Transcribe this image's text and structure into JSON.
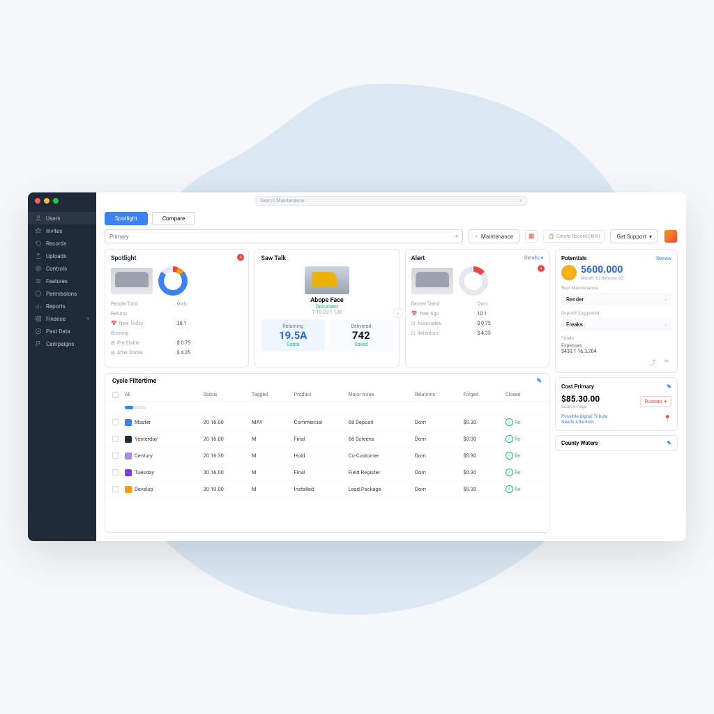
{
  "top_search_placeholder": "Search Maintenance",
  "sidebar": {
    "items": [
      {
        "label": "Users",
        "icon": "user"
      },
      {
        "label": "Invites",
        "icon": "star"
      },
      {
        "label": "Records",
        "icon": "reload"
      },
      {
        "label": "Uploads",
        "icon": "upload"
      },
      {
        "label": "Controls",
        "icon": "target"
      },
      {
        "label": "Features",
        "icon": "list"
      },
      {
        "label": "Permissions",
        "icon": "shield"
      },
      {
        "label": "Reports",
        "icon": "bar"
      },
      {
        "label": "Finance",
        "icon": "grid",
        "chev": true
      },
      {
        "label": "Past Data",
        "icon": "clock"
      },
      {
        "label": "Campaigns",
        "icon": "flag"
      }
    ]
  },
  "tabs": {
    "primary": "Spotlight",
    "secondary": "Compare"
  },
  "filters": {
    "primary_placeholder": "Primary",
    "maint_label": "Maintenance",
    "chip_label": "Create Record (⌘N)",
    "support_label": "Get Support"
  },
  "card1": {
    "title": "Spotlight",
    "k1": "People Total",
    "v1": "Owls",
    "rows": [
      {
        "k": "New Today",
        "v": "30.1"
      },
      {
        "k": "Pre-Stable",
        "v": "$ 0.75"
      },
      {
        "k": "After Stable",
        "v": "$ 4.25"
      }
    ],
    "sub1": "Returns",
    "sub2": "Running"
  },
  "card2": {
    "title": "Saw Talk",
    "name": "Abope Face",
    "sub": "Document",
    "sub2": "1.10 20:1 139",
    "stat1": {
      "lbl": "Returning",
      "val": "19.5A",
      "sub": "Costs"
    },
    "stat2": {
      "lbl": "Delivered",
      "val": "742",
      "sub": "Saved"
    }
  },
  "card3": {
    "title": "Alert",
    "head_action": "Details",
    "k1": "Recent Trend",
    "v1": "Owls",
    "rows": [
      {
        "k": "Year Ago",
        "v": "10.1"
      },
      {
        "k": "Associates",
        "v": "$ 0.75"
      },
      {
        "k": "Retention",
        "v": "$ 4.35"
      }
    ]
  },
  "table": {
    "title": "Cycle Filtertime",
    "headers": [
      "",
      "All",
      "Status",
      "Tagged",
      "Product",
      "Major Issue",
      "Relations",
      "Forged",
      "Closed"
    ],
    "rows": [
      {
        "color": "#3b82f6",
        "name": "Master",
        "c2": "20 16.00",
        "c3": "MAY",
        "c4": "Commercial",
        "c5": "68 Deposit",
        "c6": "Dorn",
        "c7": "$0.30",
        "c8": "Re"
      },
      {
        "color": "#1f2937",
        "name": "Yesterday",
        "c2": "20 16.00",
        "c3": "M",
        "c4": "Final",
        "c5": "68 Screens",
        "c6": "Dorn",
        "c7": "$0.30",
        "c8": "Re"
      },
      {
        "color": "#a78bfa",
        "name": "Century",
        "c2": "20 16.30",
        "c3": "M",
        "c4": "Hold",
        "c5": "Co-Customer",
        "c6": "Dorn",
        "c7": "$0.30",
        "c8": "Re"
      },
      {
        "color": "#7c3aed",
        "name": "Tuesday",
        "c2": "30 16.00",
        "c3": "M",
        "c4": "Final",
        "c5": "Field Register",
        "c6": "Dorn",
        "c7": "$0.30",
        "c8": "Re"
      },
      {
        "color": "#f59e0b",
        "name": "Develop",
        "c2": "30 10.00",
        "c3": "M",
        "c4": "Installed",
        "c5": "Lead Package",
        "c6": "Dorn",
        "c7": "$0.30",
        "c8": "Re"
      }
    ]
  },
  "summary": {
    "title": "Potentials",
    "action": "Review",
    "value": "5600.000",
    "sub": "Month 10 Remote 65",
    "sec1_label": "Best Maintenance",
    "row1": "Render",
    "sec2_label": "Deposit Suggested",
    "row2": "Freaks",
    "sum_label": "Totals",
    "sum_val": "Expenses",
    "sum_sub": "$430.1 16.3.204"
  },
  "cost": {
    "title": "Cost Primary",
    "amount": "$85.30.00",
    "sub": "Source Page",
    "drop": "Russian",
    "note1": "Possible Digital Tribute",
    "note2": "Needs Attention"
  },
  "footer_section": "County Waters"
}
